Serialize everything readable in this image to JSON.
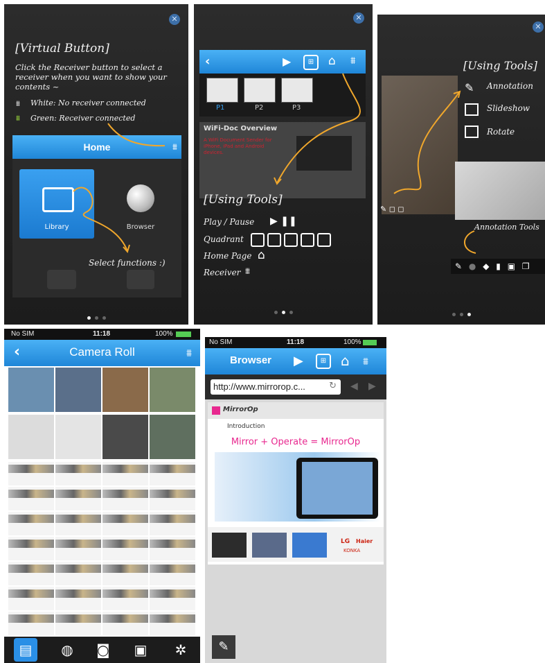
{
  "panel1": {
    "title": "[Virtual Button]",
    "desc": "Click the Receiver button to select a receiver when you want to show your contents ~",
    "white_label": "White: No receiver connected",
    "green_label": "Green: Receiver connected",
    "home_title": "Home",
    "library_label": "Library",
    "browser_label": "Browser",
    "note": "Select functions :)"
  },
  "panel2": {
    "pages": [
      "P1",
      "P2",
      "P3"
    ],
    "doc_title": "WiFi-Doc Overview",
    "doc_bullet": "A WiFi Document Sender for iPhone, iPad and Android devices.",
    "title": "[Using Tools]",
    "play_pause": "Play / Pause",
    "quadrant": "Quadrant",
    "home_page": "Home Page",
    "receiver": "Receiver"
  },
  "panel3": {
    "title": "[Using Tools]",
    "annotation": "Annotation",
    "slideshow": "Slideshow",
    "rotate": "Rotate",
    "annotation_tools": "Annotation Tools"
  },
  "panel4": {
    "carrier": "No SIM",
    "time": "11:18",
    "battery": "100%",
    "title": "Camera Roll"
  },
  "panel5": {
    "carrier": "No SIM",
    "time": "11:18",
    "battery": "100%",
    "title": "Browser",
    "url": "http://www.mirrorop.c...",
    "brand": "MirrorOp",
    "section": "Introduction",
    "headline": "Mirror + Operate = MirrorOp",
    "brand_lg": "LG",
    "brand_haier": "Haier",
    "brand_konka": "KONKA"
  },
  "colors": {
    "blue_bar": "#2a93e2",
    "arrow": "#f0a72c",
    "dark_bg": "#262626",
    "library_tile": "#2a8fe6",
    "headline": "#e8288f"
  }
}
